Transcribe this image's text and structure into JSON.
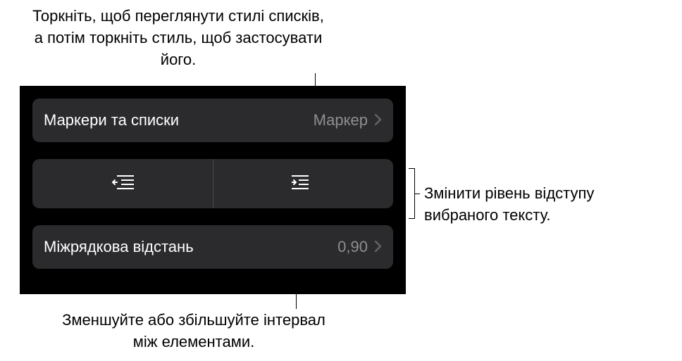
{
  "callouts": {
    "top": "Торкніть, щоб переглянути стилі списків, а потім торкніть стиль, щоб застосувати його.",
    "right": "Змінити рівень відступу вибраного тексту.",
    "bottom": "Зменшуйте або збільшуйте інтервал між елементами."
  },
  "panel": {
    "bullets_lists": {
      "label": "Маркери та списки",
      "value": "Маркер"
    },
    "line_spacing": {
      "label": "Міжрядкова відстань",
      "value": "0,90"
    }
  }
}
